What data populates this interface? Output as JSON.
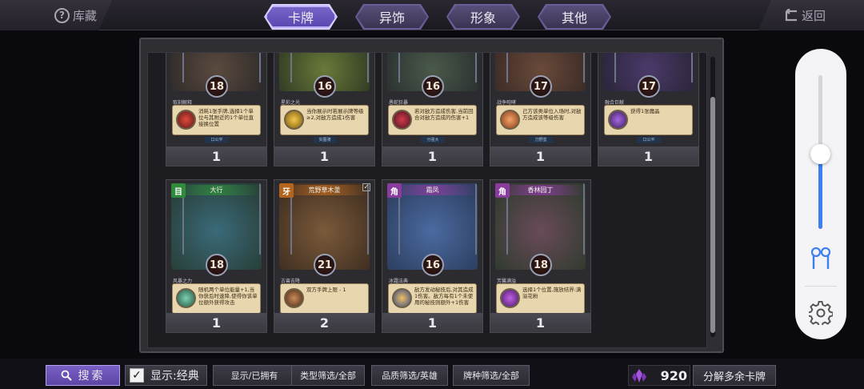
{
  "header": {
    "collection_label": "库藏",
    "back_label": "返回",
    "tabs": [
      {
        "label": "卡牌",
        "active": true
      },
      {
        "label": "异饰",
        "active": false
      },
      {
        "label": "形象",
        "active": false
      },
      {
        "label": "其他",
        "active": false
      }
    ]
  },
  "cards_row1": [
    {
      "cost": "18",
      "skill": "取刻解释",
      "desc": "消耗1张手牌,选择1个单位与其附近的1个单位直接换位置",
      "tag": "口公平",
      "count": "1",
      "icon": "red-orb-icon"
    },
    {
      "cost": "16",
      "skill": "星彩之光",
      "desc": "当你展示时若展示牌等级≥2,对敌方造成1伤害",
      "tag": "实图骑",
      "count": "1",
      "icon": "gold-sun-icon"
    },
    {
      "cost": "16",
      "skill": "愚蛇狂暴",
      "desc": "若对敌方造成伤害,当前回合对敌方造成的伤害+1",
      "tag": "分强大",
      "count": "1",
      "icon": "red-claw-icon"
    },
    {
      "cost": "17",
      "skill": "战争咆哮",
      "desc": "己方该类单位入场时,对敌方造成该等级伤害",
      "tag": "刀野蛮",
      "count": "1",
      "icon": "orange-swirl-icon"
    },
    {
      "cost": "17",
      "skill": "融合巨献",
      "desc": "获得1张魔晶",
      "tag": "口公平",
      "count": "1",
      "icon": "purple-gem-icon"
    }
  ],
  "cards_row2": [
    {
      "name": "大行",
      "class_badge": "目",
      "badge_color": "#2f8a3b",
      "cost": "18",
      "skill": "风暴之力",
      "desc": "随机两个单位能量+1,当你获后时速降,使得你该单位额外获得攻击",
      "tag": "神卡版",
      "count": "1",
      "icon": "green-wind-icon"
    },
    {
      "name": "荒野草木釜",
      "class_badge": "牙",
      "badge_color": "#b3651e",
      "cost": "21",
      "skill": "古兽吉降",
      "desc": "双方手牌上限 - 1",
      "tag": "充允旅",
      "count": "2",
      "icon": "brown-beast-icon",
      "checked": true
    },
    {
      "name": "霜凤",
      "class_badge": "角",
      "badge_color": "#8a3c9e",
      "cost": "16",
      "skill": "冰霜法典",
      "desc": "敌方发动秘技后,对其造成1伤害。敌方每有1个未使用的秘技则额外+1伤害",
      "tag": "文单层",
      "count": "1",
      "icon": "blue-ice-icon"
    },
    {
      "name": "香林园丁",
      "class_badge": "角",
      "badge_color": "#8a3c9e",
      "cost": "18",
      "skill": "芳馨满溢",
      "desc": "选择1个位置,施放结界:满溢花粉",
      "tag": "神卡版",
      "count": "1",
      "icon": "purple-flower-icon"
    }
  ],
  "bottom": {
    "search_label": "搜索",
    "display_label": "显示:经典",
    "filter_owned": "显示/已拥有",
    "filter_type": "类型筛选/全部",
    "filter_quality": "品质筛选/英雄",
    "filter_race": "牌种筛选/全部",
    "currency_value": "920",
    "decompose_label": "分解多余卡牌"
  },
  "volume": {
    "level_fraction": 0.49
  }
}
